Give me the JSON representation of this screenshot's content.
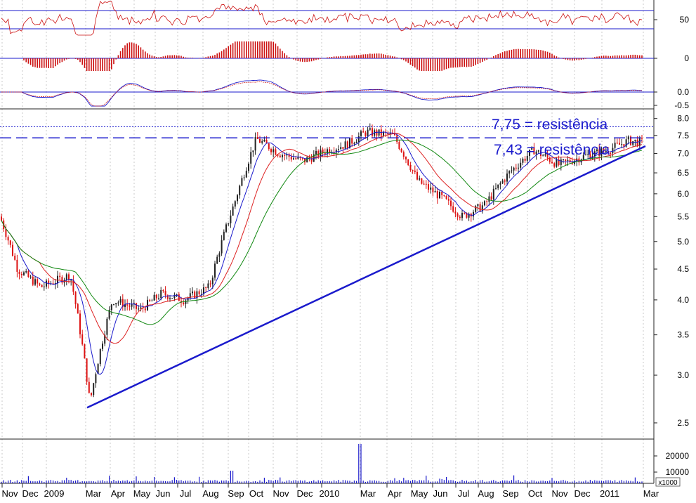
{
  "chart_data": {
    "type": "candlestick",
    "price_scale": "log",
    "price_ylim": [
      2.35,
      8.3
    ],
    "price_ticks": [
      "8.0",
      "7.5",
      "7.0",
      "6.5",
      "6.0",
      "5.5",
      "5.0",
      "4.5",
      "4.0",
      "3.5",
      "3.0",
      "2.5"
    ],
    "volume_ticks": [
      "20000",
      "10000"
    ],
    "volume_unit": "x1000",
    "oscillator1_ticks": [
      "50"
    ],
    "oscillator2_ticks": [
      "0"
    ],
    "oscillator3_ticks": [
      "0.0",
      "-0.5"
    ],
    "months": [
      "Nov",
      "Dec",
      "2009",
      "Mar",
      "Apr",
      "May",
      "Jun",
      "Jul",
      "Aug",
      "Sep",
      "Oct",
      "Nov",
      "Dec",
      "2010",
      "Mar",
      "Apr",
      "May",
      "Jun",
      "Jul",
      "Aug",
      "Sep",
      "Oct",
      "Nov",
      "Dec",
      "2011",
      "Mar"
    ],
    "annotations": [
      "7,75 = resistência",
      "7,43 = resistência"
    ],
    "resistance_levels": [
      7.75,
      7.43
    ],
    "trendline": {
      "from_label": "Mar 2009",
      "from_price": 2.65,
      "to_label": "Mar 2011",
      "to_price": 7.2
    },
    "price_path": [
      {
        "month": "Nov",
        "close": 5.5
      },
      {
        "month": "Dec",
        "close": 4.5
      },
      {
        "month": "2009",
        "close": 4.2
      },
      {
        "month": "Feb",
        "close": 4.4
      },
      {
        "month": "Mar",
        "close": 2.7
      },
      {
        "month": "Apr",
        "close": 4.0
      },
      {
        "month": "May",
        "close": 3.85
      },
      {
        "month": "Jun",
        "close": 4.1
      },
      {
        "month": "Jul",
        "close": 4.0
      },
      {
        "month": "Aug",
        "close": 4.2
      },
      {
        "month": "Sep",
        "close": 5.8
      },
      {
        "month": "Oct",
        "close": 7.4
      },
      {
        "month": "Nov",
        "close": 7.0
      },
      {
        "month": "Dec",
        "close": 6.8
      },
      {
        "month": "2010",
        "close": 7.1
      },
      {
        "month": "Feb",
        "close": 7.25
      },
      {
        "month": "Mar",
        "close": 7.6
      },
      {
        "month": "Apr",
        "close": 7.5
      },
      {
        "month": "May",
        "close": 6.3
      },
      {
        "month": "Jun",
        "close": 5.9
      },
      {
        "month": "Jul",
        "close": 5.5
      },
      {
        "month": "Aug",
        "close": 5.75
      },
      {
        "month": "Sep",
        "close": 6.5
      },
      {
        "month": "Oct",
        "close": 7.1
      },
      {
        "month": "Nov",
        "close": 6.7
      },
      {
        "month": "Dec",
        "close": 6.9
      },
      {
        "month": "2011",
        "close": 7.1
      },
      {
        "month": "Feb",
        "close": 7.35
      },
      {
        "month": "Mar",
        "close": 7.3
      }
    ]
  },
  "colors": {
    "up": "#222222",
    "down": "#dd1111",
    "ma_fast": "#1a1acc",
    "ma_mid": "#dd2222",
    "ma_slow": "#118811",
    "trendline": "#1a1acc",
    "annotation": "#1a1acc",
    "volume": "#1a1acc",
    "osc_line": "#cc1111",
    "hline": "#1a1acc",
    "grid": "#c8c8c8",
    "panel_border": "#222222"
  }
}
